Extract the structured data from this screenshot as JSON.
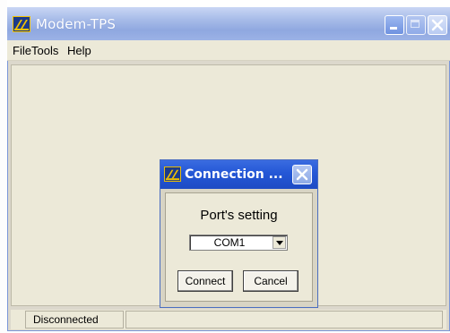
{
  "window": {
    "title": "Modem-TPS",
    "controls": [
      "minimize-icon",
      "maximize-icon",
      "close-icon"
    ]
  },
  "menu": {
    "items": [
      {
        "label": "File"
      },
      {
        "label": "Tools"
      },
      {
        "label": "Help"
      }
    ]
  },
  "dialog": {
    "title": "Connection ...",
    "port_label": "Port's setting",
    "port_select": {
      "value": "COM1"
    },
    "connect_label": "Connect",
    "cancel_label": "Cancel"
  },
  "status": {
    "text": "Disconnected"
  },
  "colors": {
    "title_bar": "#9cb2e6",
    "dialog_title_bar": "#2457d6",
    "window_face": "#ece9d8"
  }
}
